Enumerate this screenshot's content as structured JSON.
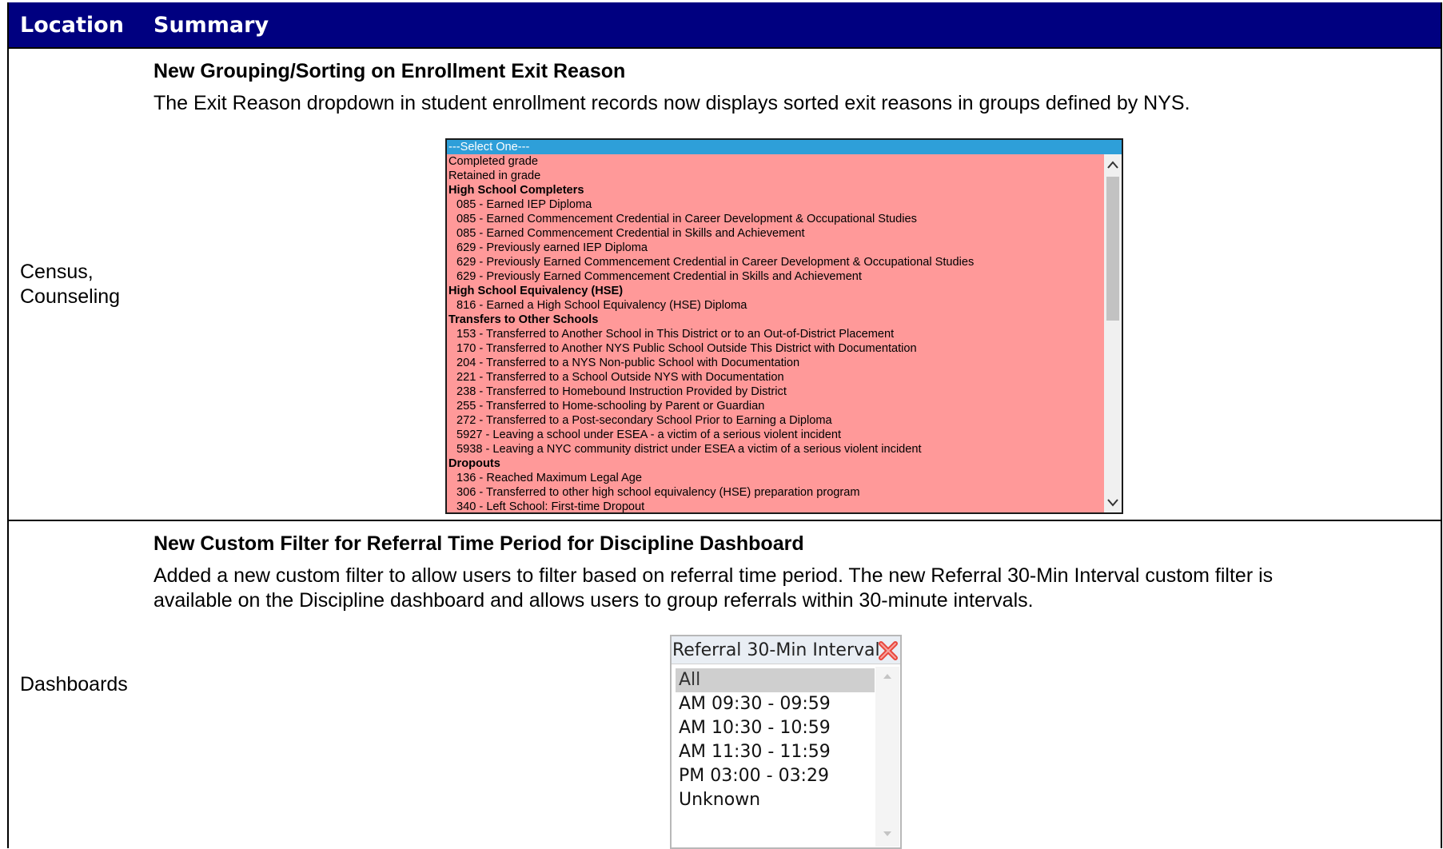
{
  "header": {
    "location": "Location",
    "summary": "Summary"
  },
  "rows": [
    {
      "location": [
        "Census,",
        "Counseling"
      ],
      "title": "New Grouping/Sorting on Enrollment Exit Reason",
      "description": "The Exit Reason dropdown in student enrollment records now displays sorted exit reasons in groups defined by NYS.",
      "listbox": {
        "selected": "---Select One---",
        "items": [
          {
            "text": "Completed grade",
            "kind": "plain"
          },
          {
            "text": "Retained in grade",
            "kind": "plain"
          },
          {
            "text": "High School Completers",
            "kind": "group"
          },
          {
            "text": "085 - Earned IEP Diploma",
            "kind": "indent"
          },
          {
            "text": "085 - Earned Commencement Credential in Career Development & Occupational Studies",
            "kind": "indent"
          },
          {
            "text": "085 - Earned Commencement Credential in Skills and Achievement",
            "kind": "indent"
          },
          {
            "text": "629 - Previously earned IEP Diploma",
            "kind": "indent"
          },
          {
            "text": "629 - Previously Earned Commencement Credential in Career Development & Occupational Studies",
            "kind": "indent"
          },
          {
            "text": "629 - Previously Earned Commencement Credential in Skills and Achievement",
            "kind": "indent"
          },
          {
            "text": "High School Equivalency (HSE)",
            "kind": "group"
          },
          {
            "text": "816 - Earned a High School Equivalency (HSE) Diploma",
            "kind": "indent"
          },
          {
            "text": "Transfers to Other Schools",
            "kind": "group"
          },
          {
            "text": "153 - Transferred to Another School in This District or to an Out-of-District Placement",
            "kind": "indent"
          },
          {
            "text": "170 - Transferred to Another NYS Public School Outside This District with Documentation",
            "kind": "indent"
          },
          {
            "text": "204 - Transferred to a NYS Non-public School with Documentation",
            "kind": "indent"
          },
          {
            "text": "221 - Transferred to a School Outside NYS with Documentation",
            "kind": "indent"
          },
          {
            "text": "238 - Transferred to Homebound Instruction Provided by District",
            "kind": "indent"
          },
          {
            "text": "255 - Transferred to Home-schooling by Parent or Guardian",
            "kind": "indent"
          },
          {
            "text": "272 - Transferred to a Post-secondary School Prior to Earning a Diploma",
            "kind": "indent"
          },
          {
            "text": "5927 - Leaving a school under ESEA - a victim of a serious violent incident",
            "kind": "indent"
          },
          {
            "text": "5938 - Leaving a NYC community district under ESEA a victim of a serious violent incident",
            "kind": "indent"
          },
          {
            "text": "Dropouts",
            "kind": "group"
          },
          {
            "text": "136 - Reached Maximum Legal Age",
            "kind": "indent"
          },
          {
            "text": "306 - Transferred to other high school equivalency (HSE) preparation program",
            "kind": "indent"
          },
          {
            "text": "340 - Left School: First-time Dropout",
            "kind": "indent"
          }
        ]
      }
    },
    {
      "location": [
        "Dashboards"
      ],
      "title": "New Custom Filter for Referral Time Period for Discipline Dashboard",
      "description": [
        "Added a new custom filter to allow users to filter based on referral time period. The new Referral 30-Min Interval custom filter is",
        "available on the Discipline dashboard and allows users to group referrals within 30-minute intervals."
      ],
      "filter": {
        "title": "Referral 30-Min Interval",
        "options": [
          "All",
          "AM 09:30 - 09:59",
          "AM 10:30 - 10:59",
          "AM 11:30 - 11:59",
          "PM 03:00 - 03:29",
          "Unknown"
        ],
        "selected_index": 0
      }
    }
  ],
  "colors": {
    "header_bg": "#000080",
    "listbox_bg": "#ff9999",
    "listbox_selected": "#2e9fd9"
  },
  "icons": {
    "close": "close-icon",
    "up": "chevron-up-icon",
    "down": "chevron-down-icon"
  }
}
